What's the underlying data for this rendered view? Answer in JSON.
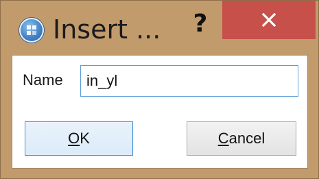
{
  "window": {
    "title": "Insert ...",
    "help_label": "?",
    "close_icon": "close-x-icon",
    "app_icon": "insert-app-icon"
  },
  "form": {
    "name_label": "Name",
    "name_value": "in_yl"
  },
  "buttons": {
    "ok_label": "OK",
    "cancel_label": "Cancel"
  },
  "colors": {
    "frame": "#c29b6d",
    "close_button": "#c7504b",
    "focus_border": "#3c8fd8"
  }
}
